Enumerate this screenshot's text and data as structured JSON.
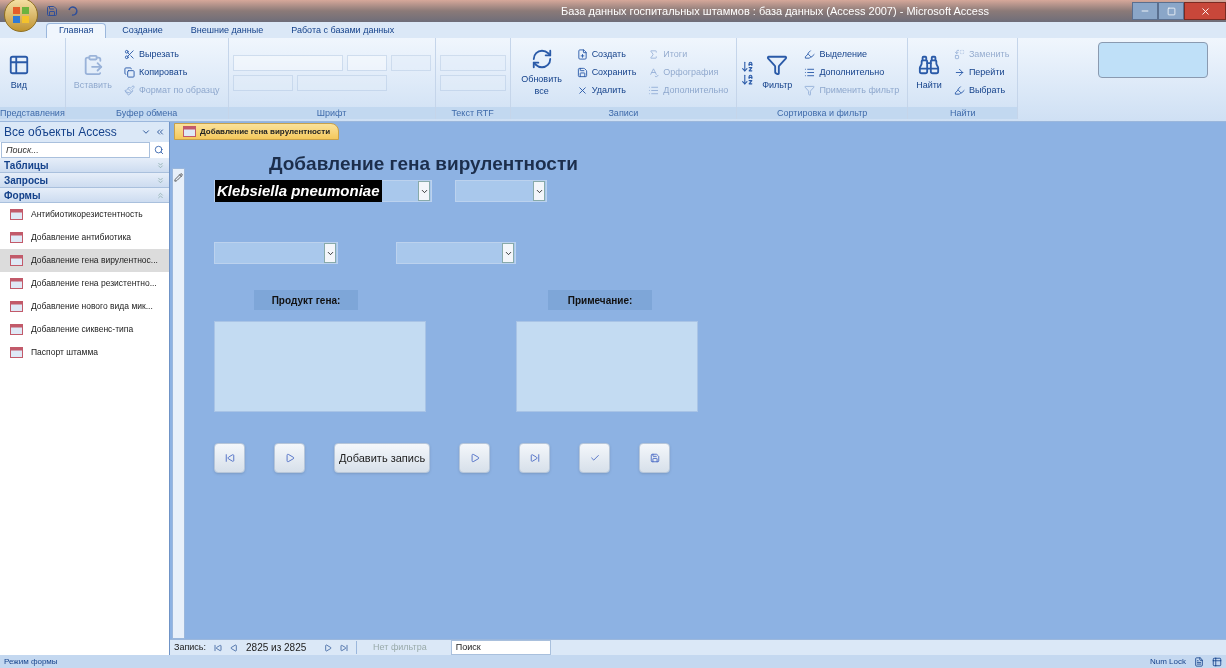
{
  "window": {
    "title": "База данных госпитальных штаммов : база данных (Access 2007) - Microsoft Access"
  },
  "ribbon_tabs": [
    {
      "label": "Главная",
      "selected": true
    },
    {
      "label": "Создание",
      "selected": false
    },
    {
      "label": "Внешние данные",
      "selected": false
    },
    {
      "label": "Работа с базами данных",
      "selected": false
    }
  ],
  "ribbon_groups": [
    {
      "label": "Представления",
      "items": [
        {
          "kind": "large",
          "label": "Вид",
          "disabled": false
        }
      ]
    },
    {
      "label": "Буфер обмена",
      "items": [
        {
          "kind": "large",
          "label": "Вставить",
          "disabled": true
        },
        {
          "kind": "small",
          "label": "Вырезать",
          "disabled": false
        },
        {
          "kind": "small",
          "label": "Копировать",
          "disabled": false
        },
        {
          "kind": "small",
          "label": "Формат по образцу",
          "disabled": true
        }
      ]
    },
    {
      "label": "Шрифт",
      "items": [
        {
          "kind": "font",
          "disabled": true
        }
      ]
    },
    {
      "label": "Текст RTF",
      "items": [
        {
          "kind": "rtf",
          "disabled": true
        }
      ]
    },
    {
      "label": "Записи",
      "items": [
        {
          "kind": "large",
          "label": "Обновить все",
          "disabled": false
        },
        {
          "kind": "small",
          "label": "Создать",
          "disabled": false
        },
        {
          "kind": "small",
          "label": "Сохранить",
          "disabled": false
        },
        {
          "kind": "small",
          "label": "Удалить",
          "disabled": false
        },
        {
          "kind": "small",
          "label": "Итоги",
          "disabled": true
        },
        {
          "kind": "small",
          "label": "Орфография",
          "disabled": true
        },
        {
          "kind": "small",
          "label": "Дополнительно",
          "disabled": true
        }
      ]
    },
    {
      "label": "Сортировка и фильтр",
      "items": [
        {
          "kind": "sort",
          "disabled": false
        },
        {
          "kind": "large",
          "label": "Фильтр",
          "disabled": false
        },
        {
          "kind": "small",
          "label": "Выделение",
          "disabled": false
        },
        {
          "kind": "small",
          "label": "Дополнительно",
          "disabled": false
        },
        {
          "kind": "small",
          "label": "Применить фильтр",
          "disabled": true
        }
      ]
    },
    {
      "label": "Найти",
      "items": [
        {
          "kind": "large",
          "label": "Найти",
          "disabled": false
        },
        {
          "kind": "small",
          "label": "Заменить",
          "disabled": true
        },
        {
          "kind": "small",
          "label": "Перейти",
          "disabled": false
        },
        {
          "kind": "small",
          "label": "Выбрать",
          "disabled": false
        }
      ]
    }
  ],
  "nav_pane": {
    "title": "Все объекты Access",
    "search": {
      "placeholder": "Поиск..."
    },
    "groups": [
      {
        "label": "Таблицы",
        "expanded": false
      },
      {
        "label": "Запросы",
        "expanded": false
      },
      {
        "label": "Формы",
        "expanded": true,
        "items": [
          {
            "label": "Антибиотикорезистентность",
            "selected": false
          },
          {
            "label": "Добавление антибиотика",
            "selected": false
          },
          {
            "label": "Добавление гена вирулентнос...",
            "selected": true
          },
          {
            "label": "Добавление гена резистентно...",
            "selected": false
          },
          {
            "label": "Добавление нового вида мик...",
            "selected": false
          },
          {
            "label": "Добавление сиквенс-типа",
            "selected": false
          },
          {
            "label": "Паспорт штамма",
            "selected": false
          }
        ]
      }
    ]
  },
  "document_tab": {
    "label": "Добавление гена вирулентности"
  },
  "form": {
    "title": "Добавление гена вирулентности",
    "combos": [
      {
        "kind": "filled",
        "value": "Klebsiella pneumoniae"
      },
      {
        "kind": "empty"
      },
      {
        "kind": "empty"
      },
      {
        "kind": "empty"
      }
    ],
    "labels": [
      "Продукт гена:",
      "Примечание:"
    ],
    "buttons": [
      {
        "kind": "first"
      },
      {
        "kind": "prev"
      },
      {
        "kind": "text",
        "label": "Добавить запись"
      },
      {
        "kind": "next"
      },
      {
        "kind": "last"
      },
      {
        "kind": "check"
      },
      {
        "kind": "save"
      }
    ]
  },
  "record_bar": {
    "label": "Запись:",
    "position": "2825 из 2825",
    "filter": "Нет фильтра",
    "search": "Поиск"
  },
  "status_bar": {
    "left": "Режим формы",
    "right": "Num Lock"
  }
}
